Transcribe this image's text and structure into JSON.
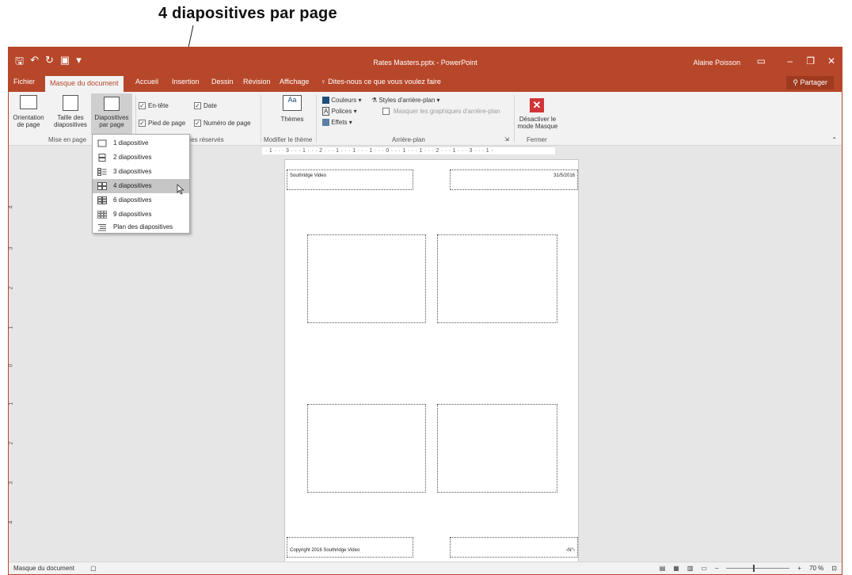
{
  "caption": "4 diapositives par page",
  "window": {
    "title": "Rates Masters.pptx - PowerPoint",
    "user": "Alaine Poisson"
  },
  "tabs": [
    "Fichier",
    "Masque du document",
    "Accueil",
    "Insertion",
    "Dessin",
    "Révision",
    "Affichage",
    "Dites-nous ce que vous voulez faire"
  ],
  "share_label": "Partager",
  "ribbon": {
    "orientation": [
      "Orientation",
      "de page"
    ],
    "taille": [
      "Taille des",
      "diapositives"
    ],
    "diapos": [
      "Diapositives",
      "par page"
    ],
    "group_mise_en_page": "Mise en page",
    "chk_entete": "En-tête",
    "chk_date": "Date",
    "chk_pied": "Pied de page",
    "chk_numero": "Numéro de page",
    "group_espaces": "Espaces réservés",
    "themes": "Thèmes",
    "group_theme": "Modifier le thème",
    "couleurs": "Couleurs",
    "polices": "Polices",
    "effets": "Effets",
    "styles": "Styles d'arrière-plan",
    "masquer": "Masquer les graphiques d'arrière-plan",
    "group_arriere": "Arrière-plan",
    "desactiver": [
      "Désactiver le",
      "mode Masque"
    ],
    "group_fermer": "Fermer"
  },
  "menu": {
    "items": [
      {
        "label": "1 diapositive",
        "selected": false
      },
      {
        "label": "2 diapositives",
        "selected": false
      },
      {
        "label": "3 diapositives",
        "selected": false
      },
      {
        "label": "4 diapositives",
        "selected": true
      },
      {
        "label": "6 diapositives",
        "selected": false
      },
      {
        "label": "9 diapositives",
        "selected": false
      },
      {
        "label": "Plan des diapositives",
        "selected": false
      }
    ]
  },
  "page": {
    "header_left": "Southridge Video",
    "header_right": "31/5/2016",
    "footer_left": "Copyright 2016 Southridge Video",
    "footer_right": "‹N°›"
  },
  "ruler": {
    "top": "· 1 · · · 3 · · · 1 · · · 2 · · · 1 · · · 1 · · · 1 · · · 0 · · · 1 · · · 1 · · · 2 · · · 1 · · · 3 · · · 1 ·",
    "left": [
      "4",
      "3",
      "2",
      "1",
      "0",
      "1",
      "2",
      "3",
      "4"
    ]
  },
  "status": {
    "mode": "Masque du document",
    "zoom": "70 %"
  },
  "colors": {
    "accent": "#b7472a",
    "ribbon": "#f2f2f2",
    "workspace": "#e6e6e6"
  }
}
